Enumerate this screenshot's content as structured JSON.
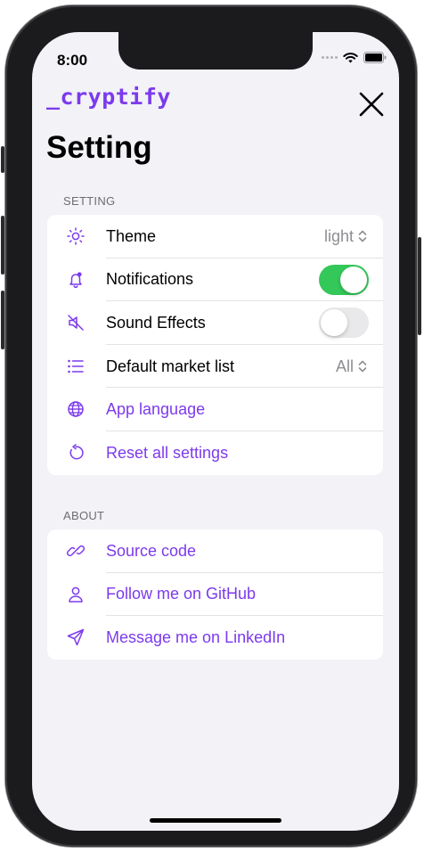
{
  "status": {
    "time": "8:00"
  },
  "header": {
    "logo": "_cryptify",
    "close_icon": "close-icon"
  },
  "page": {
    "title": "Setting"
  },
  "settings_section": {
    "header": "SETTING",
    "items": [
      {
        "icon": "sun-icon",
        "label": "Theme",
        "control": "picker",
        "value": "light"
      },
      {
        "icon": "bell-icon",
        "label": "Notifications",
        "control": "toggle",
        "on": true
      },
      {
        "icon": "speaker-muted-icon",
        "label": "Sound Effects",
        "control": "toggle",
        "on": false
      },
      {
        "icon": "list-icon",
        "label": "Default market list",
        "control": "picker",
        "value": "All"
      },
      {
        "icon": "globe-icon",
        "label": "App language",
        "control": "link"
      },
      {
        "icon": "reset-icon",
        "label": "Reset all settings",
        "control": "link"
      }
    ]
  },
  "about_section": {
    "header": "ABOUT",
    "items": [
      {
        "icon": "link-icon",
        "label": "Source code"
      },
      {
        "icon": "person-icon",
        "label": "Follow me on GitHub"
      },
      {
        "icon": "send-icon",
        "label": "Message me on LinkedIn"
      }
    ]
  },
  "colors": {
    "accent": "#7c3aed",
    "toggle_on": "#34c759",
    "background": "#f2f2f7"
  }
}
